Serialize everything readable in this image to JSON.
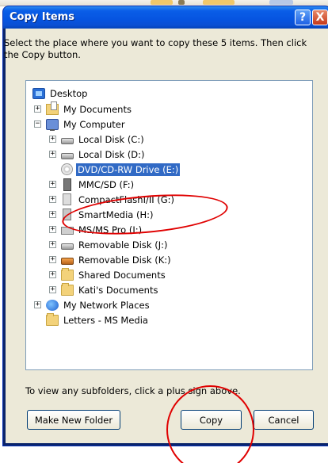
{
  "title": "Copy Items",
  "title_buttons": {
    "help": "?",
    "close": "X"
  },
  "instruction": "Select the place where you want to copy these 5 items. Then click the Copy button.",
  "tree": [
    {
      "label": "Desktop",
      "icon": "desktop-icon",
      "expander": ""
    },
    {
      "label": "My Documents",
      "icon": "my-documents-icon",
      "expander": "+"
    },
    {
      "label": "My Computer",
      "icon": "my-computer-icon",
      "expander": "−"
    },
    {
      "label": "Local Disk (C:)",
      "icon": "hard-disk-icon",
      "expander": "+"
    },
    {
      "label": "Local Disk (D:)",
      "icon": "hard-disk-icon",
      "expander": "+"
    },
    {
      "label": "DVD/CD-RW Drive (E:)",
      "icon": "cd-drive-icon",
      "expander": "",
      "selected": true
    },
    {
      "label": "MMC/SD (F:)",
      "icon": "memory-card-icon",
      "expander": "+"
    },
    {
      "label": "CompactFlashI/II (G:)",
      "icon": "compactflash-icon",
      "expander": "+"
    },
    {
      "label": "SmartMedia (H:)",
      "icon": "smartmedia-icon",
      "expander": "+"
    },
    {
      "label": "MS/MS Pro (I:)",
      "icon": "memory-stick-icon",
      "expander": "+"
    },
    {
      "label": "Removable Disk (J:)",
      "icon": "removable-disk-icon",
      "expander": "+"
    },
    {
      "label": "Removable Disk (K:)",
      "icon": "removable-disk-icon",
      "expander": "+"
    },
    {
      "label": "Shared Documents",
      "icon": "folder-icon",
      "expander": "+"
    },
    {
      "label": "Kati's Documents",
      "icon": "folder-icon",
      "expander": "+"
    },
    {
      "label": "My Network Places",
      "icon": "network-places-icon",
      "expander": "+"
    },
    {
      "label": "Letters - MS Media",
      "icon": "folder-icon",
      "expander": ""
    }
  ],
  "hint": "To view any subfolders, click a plus sign above.",
  "buttons": {
    "make_new_folder": "Make New Folder",
    "copy": "Copy",
    "cancel": "Cancel"
  },
  "colors": {
    "titlebar": "#0a5ee8",
    "selection": "#316ac5",
    "annotation": "#e00000",
    "dialog_bg": "#ece9d8"
  }
}
